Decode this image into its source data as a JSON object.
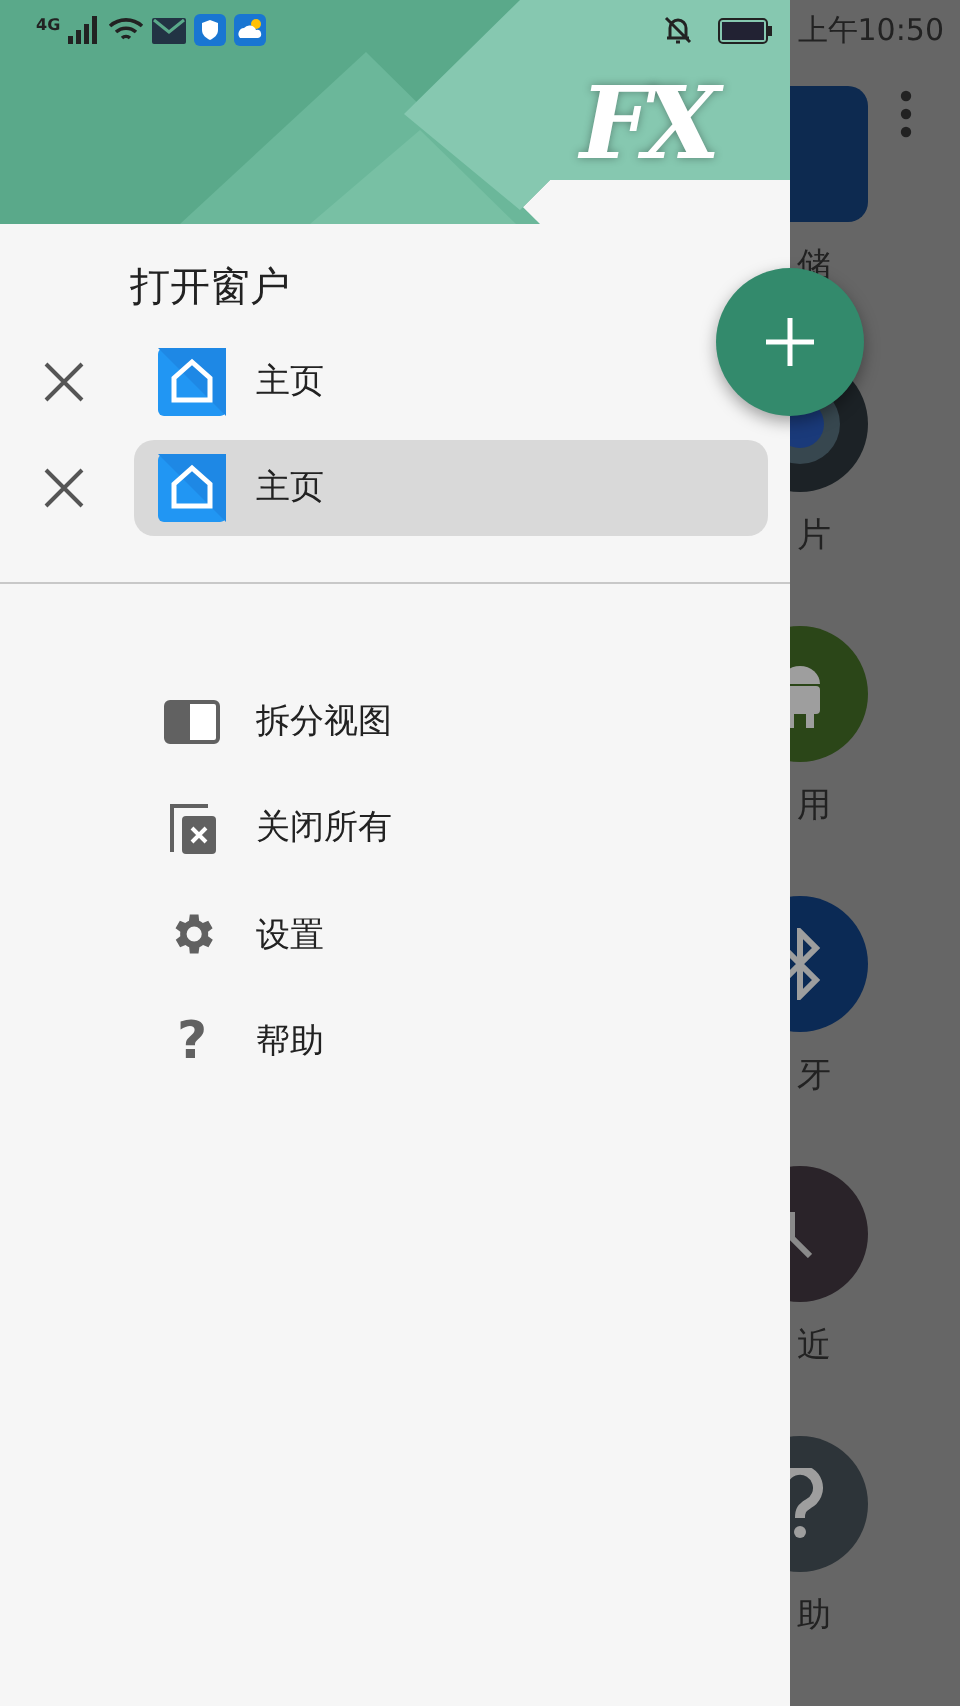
{
  "status_bar": {
    "network": "4G",
    "time": "上午10:50"
  },
  "background_app": {
    "items": [
      {
        "kind": "storage",
        "label": "储"
      },
      {
        "kind": "camera",
        "label": "片"
      },
      {
        "kind": "android",
        "label": "用"
      },
      {
        "kind": "bluetooth",
        "label": "牙"
      },
      {
        "kind": "clock",
        "label": "近"
      },
      {
        "kind": "help",
        "label": "助"
      }
    ]
  },
  "drawer": {
    "logo": "FX",
    "section_title": "打开窗户",
    "windows": [
      {
        "label": "主页",
        "selected": false
      },
      {
        "label": "主页",
        "selected": true
      }
    ],
    "menu": [
      {
        "kind": "split",
        "label": "拆分视图"
      },
      {
        "kind": "close_all",
        "label": "关闭所有"
      },
      {
        "kind": "settings",
        "label": "设置"
      },
      {
        "kind": "help",
        "label": "帮助",
        "icon_text": "?"
      }
    ]
  }
}
